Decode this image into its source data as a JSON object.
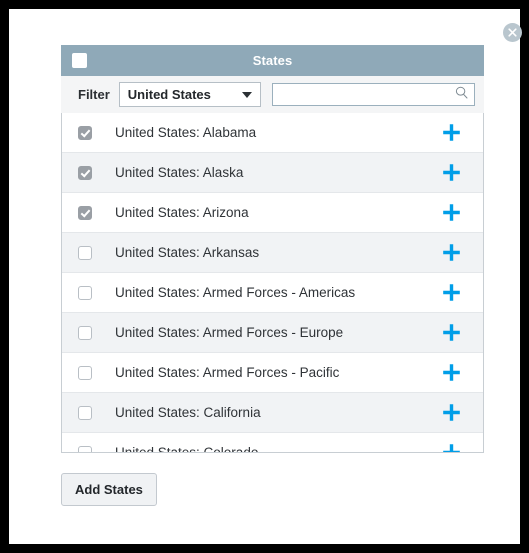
{
  "window": {
    "close_icon": "close-icon"
  },
  "panel": {
    "title": "States",
    "select_all_checkbox": "select-all-checkbox"
  },
  "filter": {
    "label": "Filter",
    "selected_value": "United States",
    "options": [
      "United States"
    ],
    "caret_icon": "chevron-down-icon"
  },
  "search": {
    "value": "",
    "placeholder": "",
    "icon": "search-icon"
  },
  "list": {
    "add_icon": "plus-icon",
    "rows": [
      {
        "label": "United States: Alabama",
        "checked": true
      },
      {
        "label": "United States: Alaska",
        "checked": true
      },
      {
        "label": "United States: Arizona",
        "checked": true
      },
      {
        "label": "United States: Arkansas",
        "checked": false
      },
      {
        "label": "United States: Armed Forces - Americas",
        "checked": false
      },
      {
        "label": "United States: Armed Forces - Europe",
        "checked": false
      },
      {
        "label": "United States: Armed Forces - Pacific",
        "checked": false
      },
      {
        "label": "United States: California",
        "checked": false
      },
      {
        "label": "United States: Colorado",
        "checked": false
      }
    ]
  },
  "footer": {
    "add_button_label": "Add States"
  },
  "colors": {
    "header_bar": "#8fa9b8",
    "plus_icon": "#009ee8",
    "close_button": "#b9c6ce",
    "row_alt": "#f1f3f5"
  }
}
